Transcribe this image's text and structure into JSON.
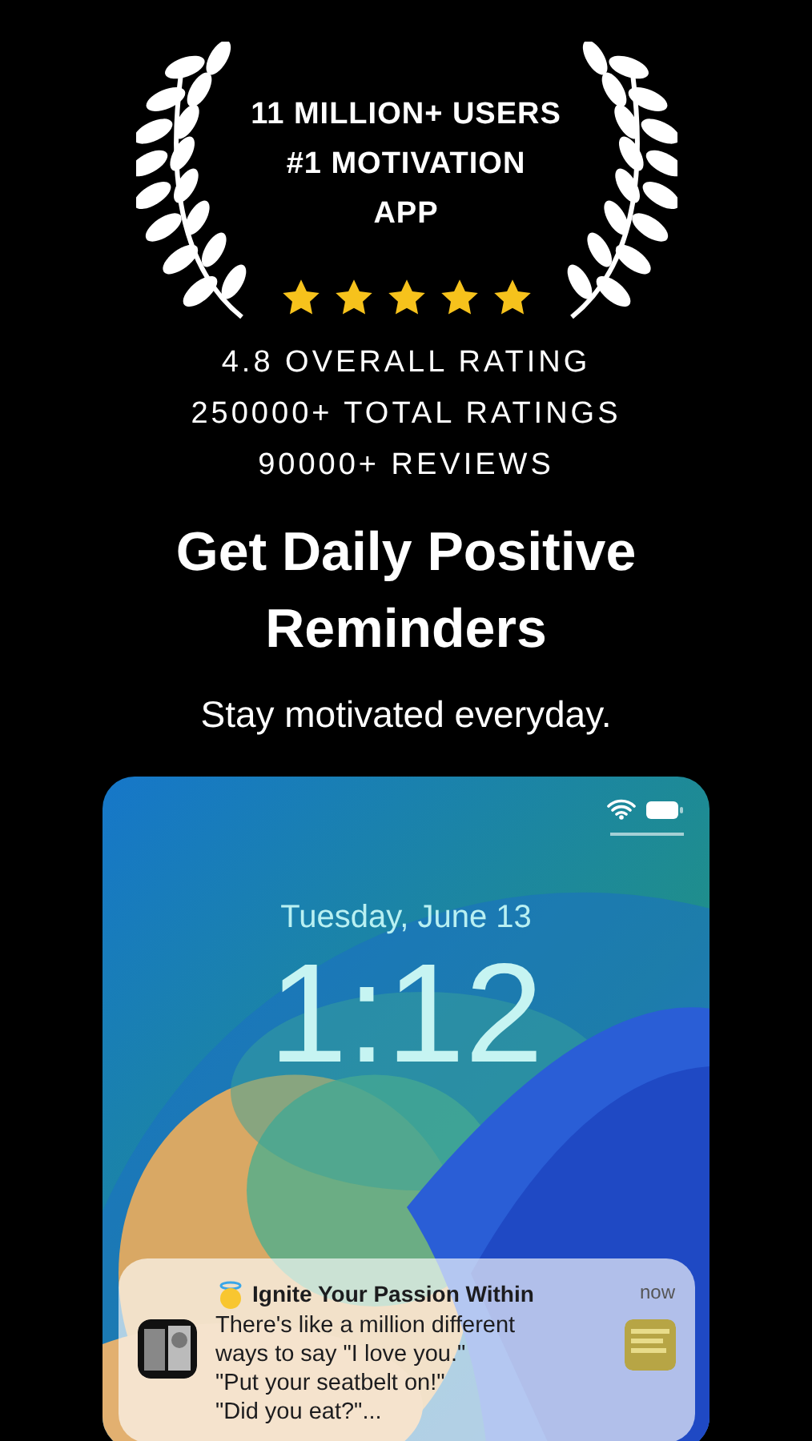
{
  "award": {
    "lines": [
      "11 MILLION+ USERS",
      "#1 MOTIVATION",
      "APP"
    ],
    "stars": 5
  },
  "stats": [
    "4.8 OVERALL RATING",
    "250000+ TOTAL RATINGS",
    "90000+ REVIEWS"
  ],
  "headline": "Get Daily Positive Reminders",
  "subtitle": "Stay motivated everyday.",
  "phone": {
    "date": "Tuesday, June 13",
    "time": "1:12",
    "notification": {
      "title": "Ignite Your Passion Within",
      "time": "now",
      "body": [
        "There's like a million different",
        "ways to say \"I love you.\"",
        "\"Put your seatbelt on!\"",
        "\"Did you eat?\"..."
      ]
    }
  }
}
